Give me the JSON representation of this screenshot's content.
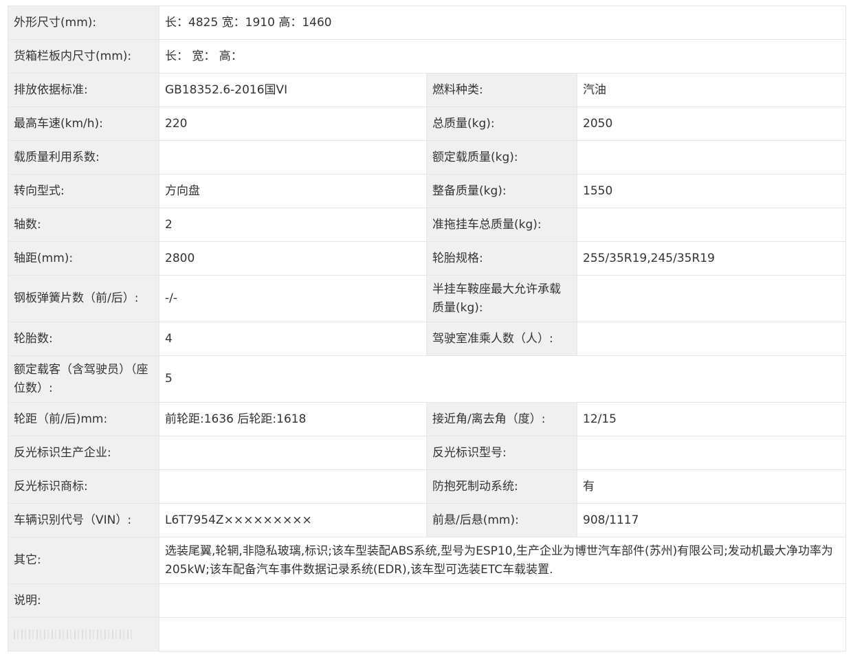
{
  "rows": {
    "dimensions": {
      "label": "外形尺寸(mm):",
      "value": "长：4825 宽：1910 高：1460"
    },
    "cargo_box": {
      "label": "货箱栏板内尺寸(mm):",
      "value": "长：  宽：  高："
    },
    "emission": {
      "label": "排放依据标准:",
      "value": "GB18352.6-2016国VI",
      "label2": "燃料种类:",
      "value2": "汽油"
    },
    "max_speed": {
      "label": "最高车速(km/h):",
      "value": "220",
      "label2": "总质量(kg):",
      "value2": "2050"
    },
    "load_factor": {
      "label": "载质量利用系数:",
      "value": "",
      "label2": "额定载质量(kg):",
      "value2": ""
    },
    "steering": {
      "label": "转向型式:",
      "value": "方向盘",
      "label2": "整备质量(kg):",
      "value2": "1550"
    },
    "axles": {
      "label": "轴数:",
      "value": "2",
      "label2": "准拖挂车总质量(kg):",
      "value2": ""
    },
    "wheelbase": {
      "label": "轴距(mm):",
      "value": "2800",
      "label2": "轮胎规格:",
      "value2": "255/35R19,245/35R19"
    },
    "leaf_springs": {
      "label": "钢板弹簧片数（前/后）:",
      "value": "-/-",
      "label2": "半挂车鞍座最大允许承载质量(kg):",
      "value2": ""
    },
    "tires": {
      "label": "轮胎数:",
      "value": "4",
      "label2": "驾驶室准乘人数（人）:",
      "value2": ""
    },
    "passengers": {
      "label": "额定载客（含驾驶员）（座位数）:",
      "value": "5"
    },
    "track": {
      "label": "轮距（前/后)mm:",
      "value": "前轮距:1636 后轮距:1618",
      "label2": "接近角/离去角（度）:",
      "value2": "12/15"
    },
    "reflector_maker": {
      "label": "反光标识生产企业:",
      "value": "",
      "label2": "反光标识型号:",
      "value2": ""
    },
    "reflector_brand": {
      "label": "反光标识商标:",
      "value": "",
      "label2": "防抱死制动系统:",
      "value2": "有"
    },
    "vin": {
      "label": "车辆识别代号（VIN）:",
      "value": "L6T7954Z×××××××××",
      "label2": "前悬/后悬(mm):",
      "value2": "908/1117"
    },
    "other": {
      "label": "其它:",
      "value": "选装尾翼,轮辋,非隐私玻璃,标识;该车型装配ABS系统,型号为ESP10,生产企业为博世汽车部件(苏州)有限公司;发动机最大净功率为205kW;该车配备汽车事件数据记录系统(EDR),该车型可选装ETC车载装置."
    },
    "notes": {
      "label": "说明:",
      "value": ""
    }
  }
}
